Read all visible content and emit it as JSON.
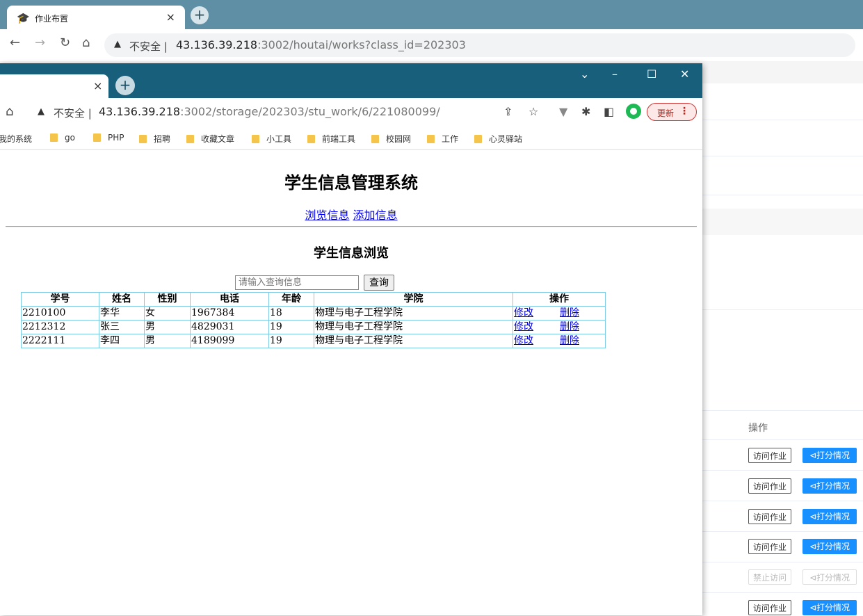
{
  "back_browser": {
    "tab_title": "作业布置",
    "insecure": "不安全",
    "url_host": "43.136.39.218",
    "url_rest": ":3002/houtai/works?class_id=202303",
    "ops_header": "操作",
    "rows": [
      {
        "visit": "访问作业",
        "score": "⊲打分情况"
      },
      {
        "visit": "访问作业",
        "score": "⊲打分情况"
      },
      {
        "visit": "访问作业",
        "score": "⊲打分情况"
      },
      {
        "visit": "访问作业",
        "score": "⊲打分情况"
      },
      {
        "visit": "禁止访问",
        "score": "⊲打分情况"
      },
      {
        "visit": "访问作业",
        "score": "⊲打分情况"
      }
    ]
  },
  "front_browser": {
    "insecure": "不安全",
    "url_host": "43.136.39.218",
    "url_rest": ":3002/storage/202303/stu_work/6/221080099/",
    "update_label": "更新",
    "bookmarks": [
      "我的系统",
      "go",
      "PHP",
      "招聘",
      "收藏文章",
      "小工具",
      "前端工具",
      "校园网",
      "工作",
      "心灵驿站"
    ]
  },
  "page": {
    "title": "学生信息管理系统",
    "nav": {
      "browse": "浏览信息",
      "add": "添加信息"
    },
    "subtitle": "学生信息浏览",
    "search_placeholder": "请输入查询信息",
    "search_button": "查询",
    "table": {
      "headers": [
        "学号",
        "姓名",
        "性别",
        "电话",
        "年龄",
        "学院",
        "操作"
      ],
      "rows": [
        {
          "id": "2210100",
          "name": "李华",
          "sex": "女",
          "phone": "1967384",
          "age": "18",
          "college": "物理与电子工程学院",
          "edit": "修改",
          "del": "删除"
        },
        {
          "id": "2212312",
          "name": "张三",
          "sex": "男",
          "phone": "4829031",
          "age": "19",
          "college": "物理与电子工程学院",
          "edit": "修改",
          "del": "删除"
        },
        {
          "id": "2222111",
          "name": "李四",
          "sex": "男",
          "phone": "4189099",
          "age": "19",
          "college": "物理与电子工程学院",
          "edit": "修改",
          "del": "删除"
        }
      ]
    }
  }
}
